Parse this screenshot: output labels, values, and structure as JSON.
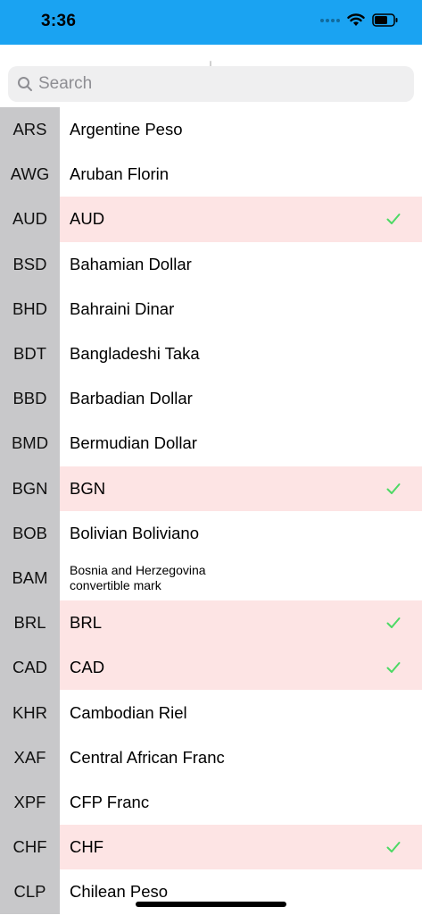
{
  "status_bar": {
    "time": "3:36",
    "background": "#1aa3f2"
  },
  "search": {
    "placeholder": "Search"
  },
  "colors": {
    "selected_row": "#fde4e4",
    "code_column": "#c8c8ca",
    "checkmark": "#4cd964"
  },
  "currencies": [
    {
      "code": "ARS",
      "name": "Argentine Peso",
      "selected": false
    },
    {
      "code": "AWG",
      "name": "Aruban Florin",
      "selected": false
    },
    {
      "code": "AUD",
      "name": "AUD",
      "selected": true
    },
    {
      "code": "BSD",
      "name": "Bahamian Dollar",
      "selected": false
    },
    {
      "code": "BHD",
      "name": "Bahraini Dinar",
      "selected": false
    },
    {
      "code": "BDT",
      "name": "Bangladeshi Taka",
      "selected": false
    },
    {
      "code": "BBD",
      "name": "Barbadian Dollar",
      "selected": false
    },
    {
      "code": "BMD",
      "name": "Bermudian Dollar",
      "selected": false
    },
    {
      "code": "BGN",
      "name": "BGN",
      "selected": true
    },
    {
      "code": "BOB",
      "name": "Bolivian Boliviano",
      "selected": false
    },
    {
      "code": "BAM",
      "name": "Bosnia and Herzegovina\nconvertible mark",
      "selected": false,
      "small": true
    },
    {
      "code": "BRL",
      "name": "BRL",
      "selected": true
    },
    {
      "code": "CAD",
      "name": "CAD",
      "selected": true
    },
    {
      "code": "KHR",
      "name": "Cambodian Riel",
      "selected": false
    },
    {
      "code": "XAF",
      "name": "Central African Franc",
      "selected": false
    },
    {
      "code": "XPF",
      "name": "CFP Franc",
      "selected": false
    },
    {
      "code": "CHF",
      "name": "CHF",
      "selected": true
    },
    {
      "code": "CLP",
      "name": "Chilean Peso",
      "selected": false
    }
  ]
}
